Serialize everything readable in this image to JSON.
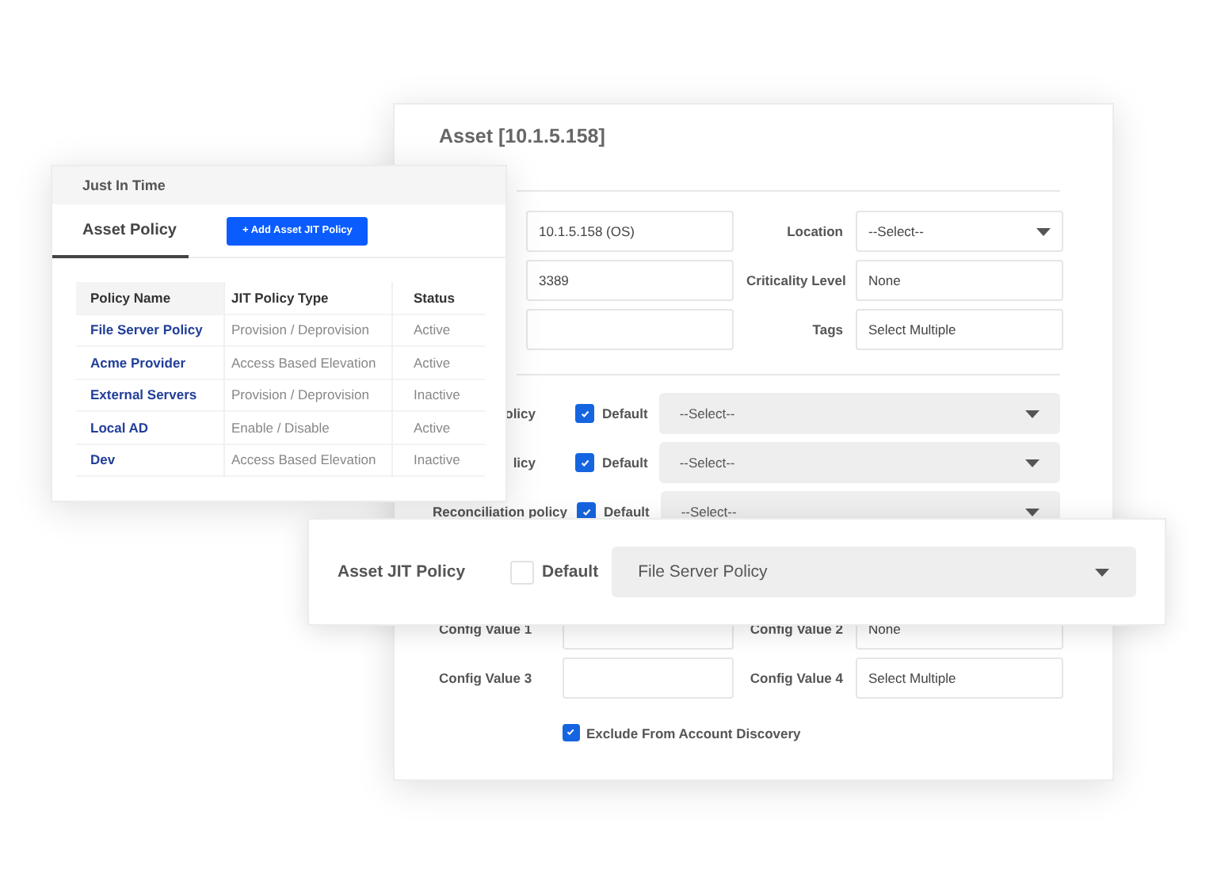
{
  "asset_panel": {
    "title": "Asset [10.1.5.158]",
    "rows": [
      {
        "left": {
          "value": "10.1.5.158 (OS)"
        },
        "right": {
          "label": "Location",
          "value": "--Select--",
          "dropdown": true
        }
      },
      {
        "left": {
          "value": "3389"
        },
        "right": {
          "label": "Criticality Level",
          "value": "None",
          "dropdown": false
        }
      },
      {
        "left": {},
        "right": {
          "label": "Tags",
          "value": "Select Multiple",
          "dropdown": false
        }
      }
    ],
    "policies": [
      {
        "label": "olicy",
        "default": {
          "label": "Default",
          "checked": true
        },
        "value": "--Select--"
      },
      {
        "label": "licy",
        "default": {
          "label": "Default",
          "checked": true
        },
        "value": "--Select--"
      },
      {
        "label": "Reconciliation policy",
        "default": {
          "label": "Default",
          "checked": true
        },
        "value": "--Select--"
      }
    ],
    "config": [
      {
        "left": {
          "label": "Config Value 1"
        },
        "right": {
          "label": "Config Value 2",
          "value": "None"
        }
      },
      {
        "left": {
          "label": "Config Value 3"
        },
        "right": {
          "label": "Config Value 4",
          "value": "Select Multiple"
        }
      }
    ],
    "exclude": {
      "label": "Exclude From Account Discovery",
      "checked": true
    }
  },
  "jit_panel": {
    "title": "Just In Time",
    "tabs": [
      {
        "label": "Asset Policy",
        "selected": true
      }
    ],
    "add_button": "+ Add Asset JIT Policy",
    "table": {
      "columns": [
        "Policy Name",
        "JIT Policy Type",
        "Status"
      ],
      "rows": [
        [
          "File Server Policy",
          "Provision / Deprovision",
          "Active"
        ],
        [
          "Acme Provider",
          "Access Based Elevation",
          "Active"
        ],
        [
          "External Servers",
          "Provision / Deprovision",
          "Inactive"
        ],
        [
          "Local AD",
          "Enable / Disable",
          "Active"
        ],
        [
          "Dev",
          "Access Based Elevation",
          "Inactive"
        ]
      ]
    }
  },
  "asset_jit_policy": {
    "label": "Asset JIT Policy",
    "default": {
      "label": "Default",
      "checked": false
    },
    "value": "File Server Policy"
  }
}
